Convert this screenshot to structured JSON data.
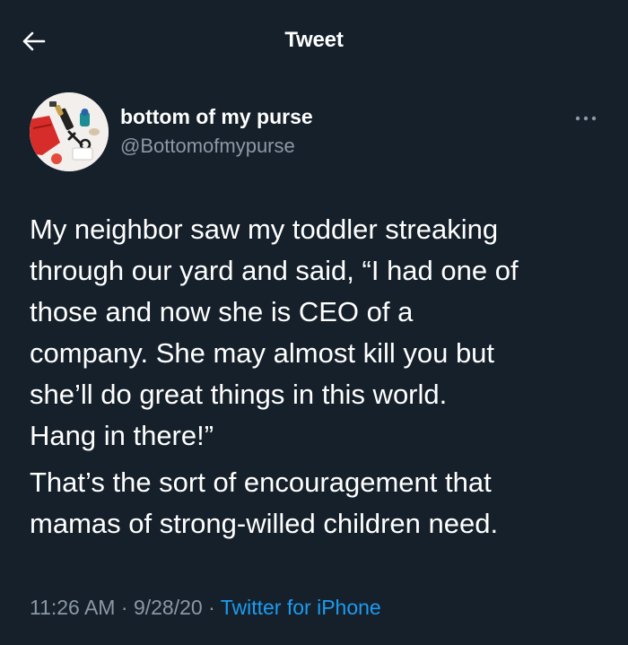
{
  "header": {
    "title": "Tweet",
    "back_icon": "arrow-left-icon"
  },
  "author": {
    "display_name": "bottom of my purse",
    "handle": "@Bottomofmypurse",
    "avatar": "purse-items-avatar",
    "more_icon": "more-horizontal-icon"
  },
  "tweet": {
    "paragraph_1_lines": [
      "My neighbor saw my toddler streaking",
      "through our yard and said, “I had one of",
      "those and now she is CEO of a",
      "company. She may almost kill you but",
      "she’ll do great things in this world.",
      "Hang in there!”"
    ],
    "paragraph_2_lines": [
      "That’s the sort of encouragement that",
      "mamas of strong-willed children need."
    ]
  },
  "meta": {
    "time": "11:26 AM",
    "separator": "·",
    "date": "9/28/20",
    "source": "Twitter for iPhone"
  },
  "colors": {
    "background": "#15202b",
    "primary_text": "#ffffff",
    "secondary_text": "#8b98a5",
    "link": "#1d9bf0"
  }
}
